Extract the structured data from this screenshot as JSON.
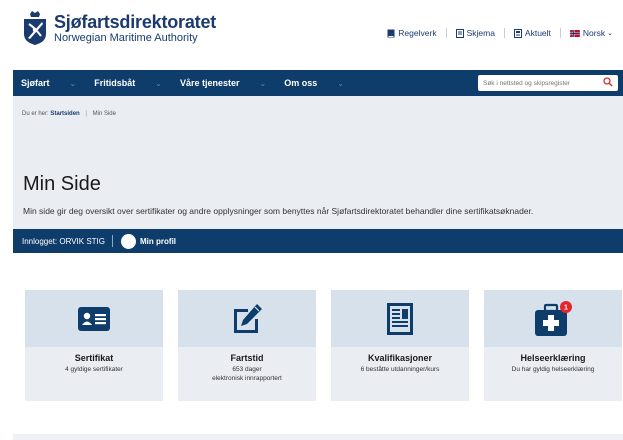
{
  "header": {
    "logo_title": "Sjøfartsdirektoratet",
    "logo_subtitle": "Norwegian Maritime Authority",
    "links": [
      {
        "label": "Regelverk",
        "icon": "book-icon"
      },
      {
        "label": "Skjema",
        "icon": "form-icon"
      },
      {
        "label": "Aktuelt",
        "icon": "news-icon"
      },
      {
        "label": "Norsk",
        "icon": "norway-flag-icon"
      }
    ]
  },
  "nav": {
    "items": [
      "Sjøfart",
      "Fritidsbåt",
      "Våre tjenester",
      "Om oss"
    ],
    "search_placeholder": "Søk i nettsted og skipsregister"
  },
  "breadcrumb": {
    "prefix": "Du er her:",
    "home": "Startsiden",
    "current": "Min Side"
  },
  "page": {
    "title": "Min Side",
    "description": "Min side gir deg oversikt over sertifikater og andre opplysninger som benyttes når Sjøfartsdirektoratet behandler dine sertifikatsøknader."
  },
  "status": {
    "logged_in": "Innlogget: ORVIK STIG",
    "profile": "Min profil"
  },
  "cards": [
    {
      "title": "Sertifikat",
      "sub1": "4 gyldige sertifikater",
      "sub2": "",
      "icon": "id-card-icon"
    },
    {
      "title": "Fartstid",
      "sub1": "653 dager",
      "sub2": "elektronisk innrapportert",
      "icon": "edit-icon"
    },
    {
      "title": "Kvalifikasjoner",
      "sub1": "6 beståtte utdanninger/kurs",
      "sub2": "",
      "icon": "document-icon"
    },
    {
      "title": "Helseerklæring",
      "sub1": "Du har gyldig helseerklæring",
      "sub2": "",
      "icon": "medical-kit-icon",
      "badge": "1"
    }
  ],
  "colors": {
    "navy": "#0f3d6b",
    "logo": "#1b3b6f",
    "band": "#eaedf2",
    "card_top": "#d6e1ec",
    "badge": "#e3262e",
    "search_icon": "#d32f2f"
  }
}
